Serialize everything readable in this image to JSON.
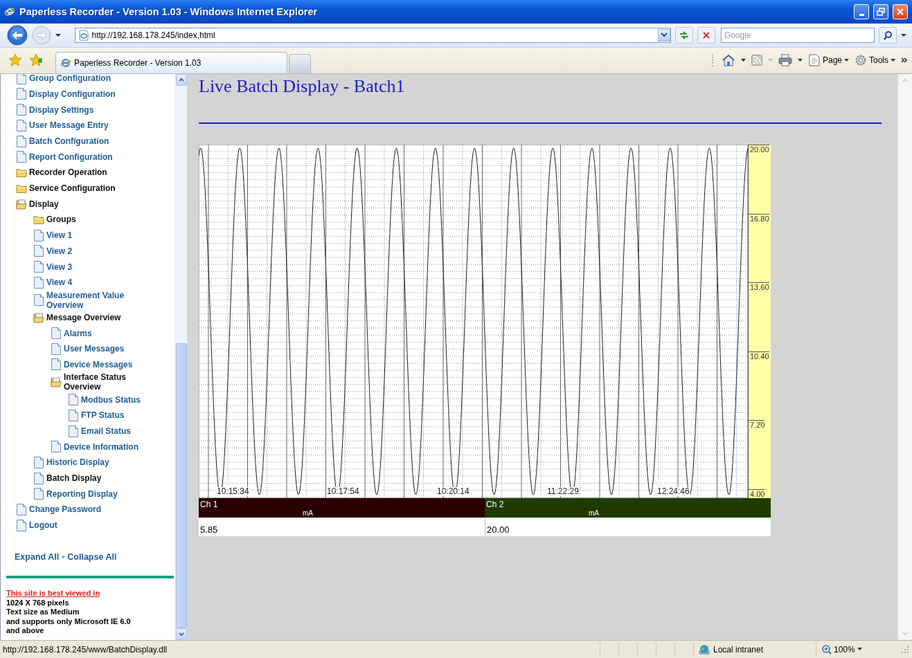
{
  "window": {
    "title": "Paperless Recorder - Version 1.03 - Windows Internet Explorer"
  },
  "address_bar": {
    "url": "http://192.168.178.245/index.html"
  },
  "search": {
    "placeholder": "Google"
  },
  "tabs": [
    {
      "label": "Paperless Recorder - Version 1.03",
      "selected": true
    }
  ],
  "command_bar": [
    {
      "kind": "home"
    },
    {
      "kind": "feeds"
    },
    {
      "kind": "print"
    },
    {
      "kind": "page",
      "label": "Page"
    },
    {
      "kind": "tools",
      "label": "Tools"
    }
  ],
  "sidebar": {
    "items": [
      {
        "label": "Group Configuration",
        "kind": "page",
        "selected": false
      },
      {
        "label": "Display Configuration",
        "kind": "page",
        "selected": false
      },
      {
        "label": "Display Settings",
        "kind": "page",
        "selected": false
      },
      {
        "label": "User Message Entry",
        "kind": "page",
        "selected": false
      },
      {
        "label": "Batch Configuration",
        "kind": "page",
        "selected": false
      },
      {
        "label": "Report Configuration",
        "kind": "page",
        "selected": false
      },
      {
        "label": "Recorder Operation",
        "kind": "folder",
        "expanded": false,
        "selected": false
      },
      {
        "label": "Service Configuration",
        "kind": "folder",
        "expanded": false,
        "selected": false
      },
      {
        "label": "Display",
        "kind": "folder",
        "expanded": true,
        "selected": false,
        "children": [
          {
            "label": "Groups",
            "kind": "folder",
            "expanded": false,
            "selected": false
          },
          {
            "label": "View 1",
            "kind": "page",
            "selected": false
          },
          {
            "label": "View 2",
            "kind": "page",
            "selected": false
          },
          {
            "label": "View 3",
            "kind": "page",
            "selected": false
          },
          {
            "label": "View 4",
            "kind": "page",
            "selected": false
          },
          {
            "label": "Measurement Value Overview",
            "kind": "page",
            "selected": false
          },
          {
            "label": "Message Overview",
            "kind": "folder",
            "expanded": true,
            "selected": false,
            "children": [
              {
                "label": "Alarms",
                "kind": "page",
                "selected": false
              },
              {
                "label": "User Messages",
                "kind": "page",
                "selected": false
              },
              {
                "label": "Device Messages",
                "kind": "page",
                "selected": false
              },
              {
                "label": "Interface Status Overview",
                "kind": "folder",
                "expanded": true,
                "selected": false,
                "children": [
                  {
                    "label": "Modbus Status",
                    "kind": "page",
                    "selected": false
                  },
                  {
                    "label": "FTP Status",
                    "kind": "page",
                    "selected": false
                  },
                  {
                    "label": "Email Status",
                    "kind": "page",
                    "selected": false
                  }
                ]
              },
              {
                "label": "Device Information",
                "kind": "page",
                "selected": false
              }
            ]
          },
          {
            "label": "Historic Display",
            "kind": "page",
            "selected": false
          },
          {
            "label": "Batch Display",
            "kind": "page",
            "selected": true
          },
          {
            "label": "Reporting Display",
            "kind": "page",
            "selected": false
          }
        ]
      },
      {
        "label": "Change Password",
        "kind": "page",
        "selected": false
      },
      {
        "label": "Logout",
        "kind": "page",
        "selected": false
      }
    ],
    "expand_all": "Expand All",
    "link_separator": "-",
    "collapse_all": "Collapse All",
    "notice_link": "This site is best viewed in",
    "notice_lines": [
      "1024 X 768 pixels",
      "Text size as Medium",
      "and supports only Microsoft IE 6.0",
      "and above"
    ]
  },
  "batch_display": {
    "title": "Live Batch Display - Batch1",
    "y_labels": [
      "20.00",
      "16.80",
      "13.60",
      "10.40",
      "7.20",
      "4.00"
    ],
    "time_labels": [
      "10:15:34",
      "10:17:54",
      "10:20:14",
      "11:22:29",
      "12:24:46"
    ],
    "channels": [
      {
        "name": "Ch 1",
        "unit": "mA",
        "value": "5.85",
        "color": "#2a0000"
      },
      {
        "name": "Ch 2",
        "unit": "mA",
        "value": "20.00",
        "color": "#1f3b00"
      }
    ]
  },
  "status_bar": {
    "url": "http://192.168.178.245/www/BatchDisplay.dll",
    "zone": "Local intranet",
    "zoom": "100%"
  }
}
